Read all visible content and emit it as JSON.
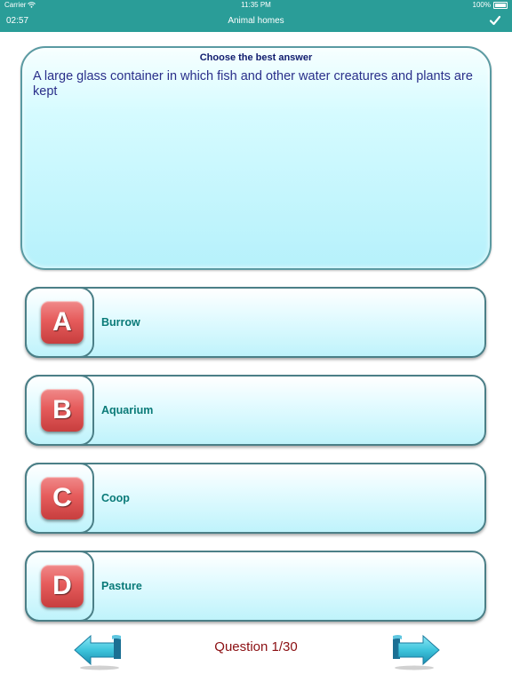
{
  "status_bar": {
    "carrier": "Carrier",
    "time": "11:35 PM",
    "battery": "100%"
  },
  "nav": {
    "timer": "02:57",
    "title": "Animal homes",
    "confirm_icon": "checkmark-icon"
  },
  "question": {
    "heading": "Choose the best answer",
    "text": "A large glass container in which fish and other water creatures and plants are kept"
  },
  "answers": [
    {
      "letter": "A",
      "text": "Burrow"
    },
    {
      "letter": "B",
      "text": "Aquarium"
    },
    {
      "letter": "C",
      "text": "Coop"
    },
    {
      "letter": "D",
      "text": "Pasture"
    }
  ],
  "footer": {
    "progress": "Question 1/30",
    "prev_icon": "arrow-left-icon",
    "next_icon": "arrow-right-icon"
  },
  "colors": {
    "header": "#2a9d98",
    "answer_text": "#0a7a78",
    "letter_badge": "#e65c5c",
    "progress_text": "#8b0f12",
    "question_text": "#2a2f8a"
  }
}
